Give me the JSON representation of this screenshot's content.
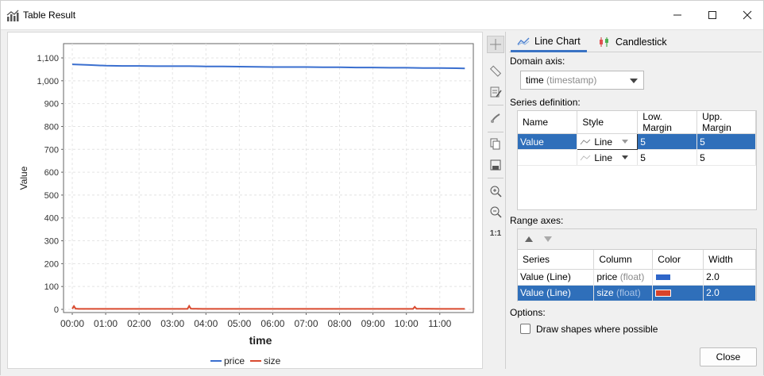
{
  "window": {
    "title": "Table Result"
  },
  "chart_data": {
    "type": "line",
    "xlabel": "time",
    "ylabel": "Value",
    "ylim": [
      0,
      1100
    ],
    "y_ticks": [
      "0",
      "100",
      "200",
      "300",
      "400",
      "500",
      "600",
      "700",
      "800",
      "900",
      "1,000",
      "1,100"
    ],
    "x_ticks": [
      "00:00",
      "01:00",
      "02:00",
      "03:00",
      "04:00",
      "05:00",
      "06:00",
      "07:00",
      "08:00",
      "09:00",
      "10:00",
      "11:00"
    ],
    "grid": true,
    "legend_position": "bottom",
    "series": [
      {
        "name": "price",
        "color": "#3a6fcf",
        "x": [
          0,
          0.5,
          1,
          1.5,
          2,
          2.5,
          3,
          3.5,
          4,
          4.5,
          5,
          5.5,
          6,
          6.5,
          7,
          7.5,
          8,
          8.5,
          9,
          9.5,
          10,
          10.5,
          11,
          11.5,
          11.75
        ],
        "values": [
          1072,
          1069,
          1066,
          1065,
          1065,
          1064,
          1064,
          1064,
          1063,
          1063,
          1062,
          1061,
          1060,
          1060,
          1060,
          1059,
          1059,
          1058,
          1058,
          1057,
          1057,
          1056,
          1056,
          1055,
          1054
        ]
      },
      {
        "name": "size",
        "color": "#d94a2f",
        "x": [
          0,
          0.05,
          0.1,
          0.2,
          1,
          2,
          3,
          3.45,
          3.5,
          3.55,
          4,
          5,
          6,
          7,
          8,
          9,
          10.2,
          10.25,
          10.3,
          11,
          11.75
        ],
        "values": [
          2,
          14,
          3,
          2,
          2,
          2,
          2,
          2,
          15,
          3,
          2,
          2,
          2,
          2,
          2,
          2,
          2,
          11,
          3,
          2,
          2
        ]
      }
    ]
  },
  "toolbar": {
    "icons": [
      "crosshair-icon",
      "ruler-icon",
      "edit-icon",
      "brush-icon",
      "copy-icon",
      "save-icon",
      "zoom-in-icon",
      "zoom-out-icon",
      "one-to-one-icon"
    ],
    "one_to_one_label": "1:1"
  },
  "tabs": [
    {
      "label": "Line Chart",
      "active": true
    },
    {
      "label": "Candlestick",
      "active": false
    }
  ],
  "domain_axis": {
    "label": "Domain axis:",
    "selected_value": "time",
    "selected_type": "(timestamp)"
  },
  "series_definition": {
    "label": "Series definition:",
    "headers": [
      "Name",
      "Style",
      "Low. Margin",
      "Upp. Margin"
    ],
    "rows": [
      {
        "name": "Value",
        "style": "Line",
        "low_margin": "5",
        "upp_margin": "5",
        "selected": true
      },
      {
        "name": "",
        "style": "Line",
        "low_margin": "5",
        "upp_margin": "5",
        "selected": false
      }
    ]
  },
  "range_axes": {
    "label": "Range axes:",
    "headers": [
      "Series",
      "Column",
      "Color",
      "Width"
    ],
    "rows": [
      {
        "series": "Value (Line)",
        "column": "price",
        "column_type": "(float)",
        "color": "#2f66c9",
        "width": "2.0",
        "selected": false
      },
      {
        "series": "Value (Line)",
        "column": "size",
        "column_type": "(float)",
        "color": "#d8432a",
        "width": "2.0",
        "selected": true
      }
    ]
  },
  "options": {
    "label": "Options:",
    "draw_shapes_label": "Draw shapes where possible",
    "draw_shapes_checked": false
  },
  "close_label": "Close"
}
